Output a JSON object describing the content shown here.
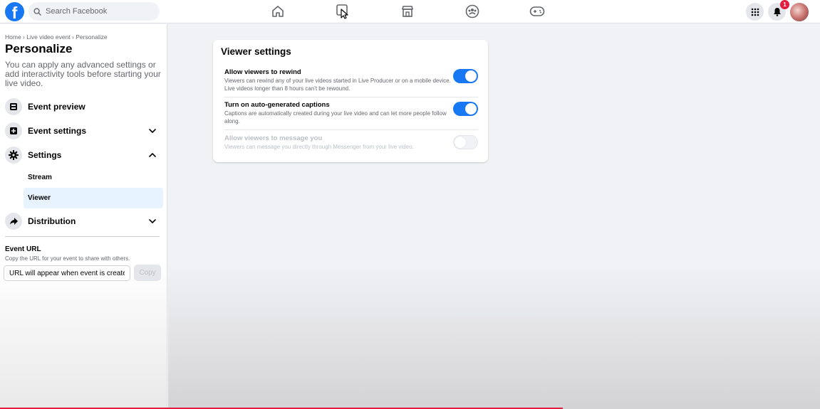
{
  "topbar": {
    "search_placeholder": "Search Facebook",
    "notification_count": "1",
    "nav_icons": [
      "home-icon",
      "watch-icon",
      "marketplace-icon",
      "groups-icon",
      "gaming-icon"
    ],
    "right_icons": [
      "menu-grid-icon",
      "notifications-icon",
      "account-avatar"
    ]
  },
  "sidebar": {
    "breadcrumb": "Home › Live video event › Personalize",
    "title": "Personalize",
    "description": "You can apply any advanced settings or add interactivity tools before starting your live video.",
    "items": [
      {
        "label": "Event preview",
        "icon": "preview-icon"
      },
      {
        "label": "Event settings",
        "icon": "settings-card-icon",
        "chevron": "down"
      },
      {
        "label": "Settings",
        "icon": "gear-icon",
        "chevron": "up"
      },
      {
        "label": "Distribution",
        "icon": "share-icon",
        "chevron": "down"
      }
    ],
    "sub_items": [
      {
        "label": "Stream"
      },
      {
        "label": "Viewer",
        "active": true
      }
    ],
    "event_url": {
      "title": "Event URL",
      "description": "Copy the URL for your event to share with others.",
      "placeholder": "URL will appear when event is created",
      "copy_label": "Copy"
    }
  },
  "card": {
    "title": "Viewer settings",
    "settings": [
      {
        "title": "Allow viewers to rewind",
        "description": "Viewers can rewind any of your live videos started in Live Producer or on a mobile device. Live videos longer than 8 hours can't be rewound.",
        "enabled": true
      },
      {
        "title": "Turn on auto-generated captions",
        "description": "Captions are automatically created during your live video and can let more people follow along.",
        "enabled": true
      },
      {
        "title": "Allow viewers to message you",
        "description": "Viewers can message you directly through Messenger from your live video.",
        "enabled": false,
        "disabled": true
      }
    ]
  },
  "colors": {
    "brand": "#1877f2",
    "badge": "#e41e3f",
    "background": "#f0f2f5"
  }
}
